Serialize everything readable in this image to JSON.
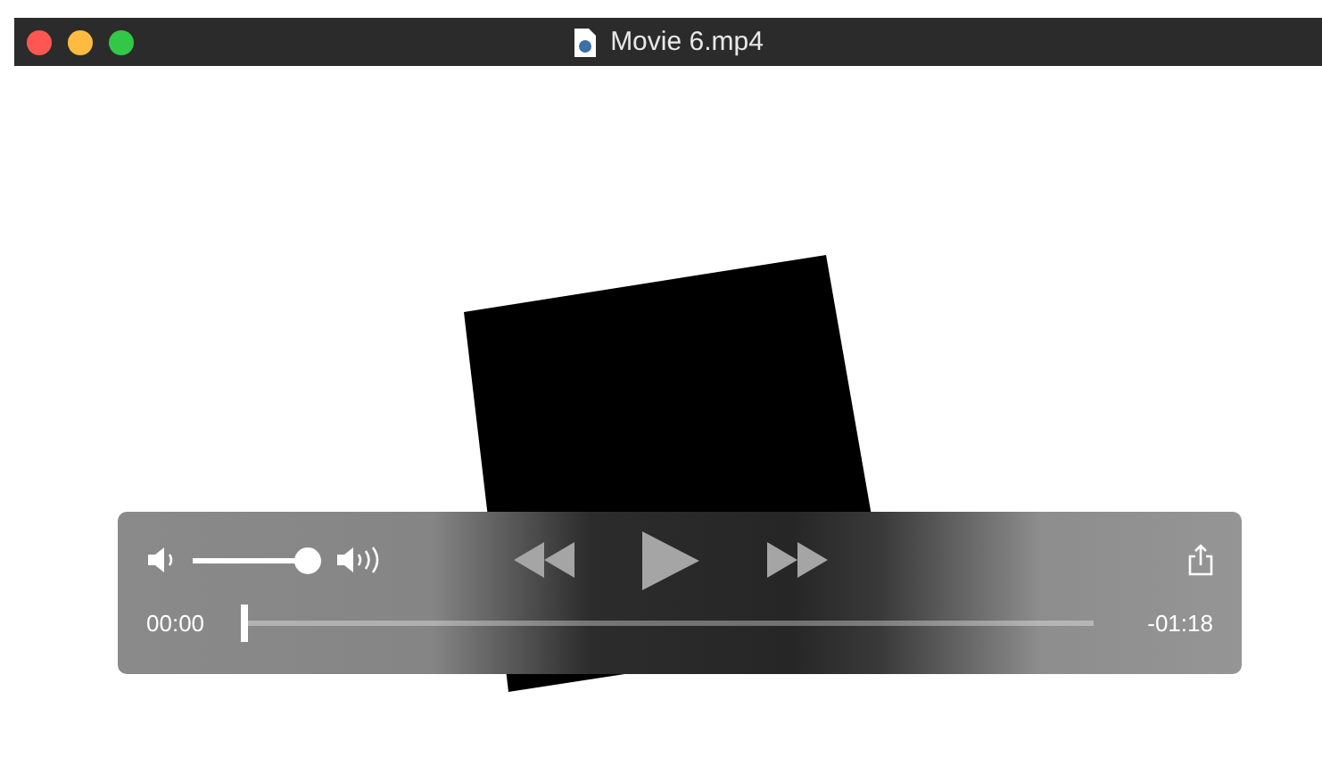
{
  "window": {
    "title": "Movie 6.mp4"
  },
  "controls": {
    "volume": {
      "level": 1
    },
    "scrubber": {
      "level": 0
    },
    "elapsed": "00:00",
    "remaining": "-01:18"
  }
}
